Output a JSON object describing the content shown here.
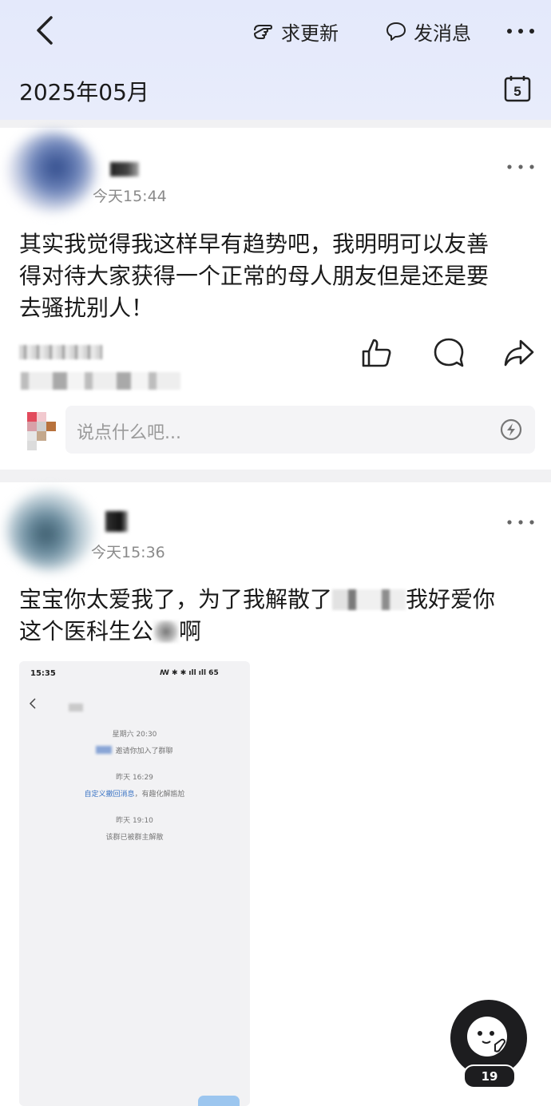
{
  "header": {
    "request_update_label": "求更新",
    "message_label": "发消息",
    "month": "2025年05月",
    "calendar_day": "5"
  },
  "posts": [
    {
      "time": "今天15:44",
      "text_lines": [
        "其实我觉得我这样早有趋势吧，我明明可以友善",
        "得对待大家获得一个正常的母人朋友但是还是要",
        "去骚扰别人！"
      ],
      "comment_placeholder": "说点什么吧..."
    },
    {
      "time": "今天15:36",
      "text_line1_a": "宝宝你太爱我了，为了我解散了",
      "text_line1_b": "我好爱你",
      "text_line2_a": "这个医科生公",
      "text_line2_b": "啊",
      "screenshot": {
        "status_time": "15:35",
        "status_icons": "ꟿ ✱ ✱ ıll ıll 65",
        "line1": "星期六 20:30",
        "line2": "邀请你加入了群聊",
        "line3": "昨天 16:29",
        "line4_link": "自定义撤回消息",
        "line4_rest": "，有趣化解尴尬",
        "line5": "昨天 19:10",
        "line6": "该群已被群主解散"
      }
    }
  ],
  "fab": {
    "badge_count": "19"
  }
}
